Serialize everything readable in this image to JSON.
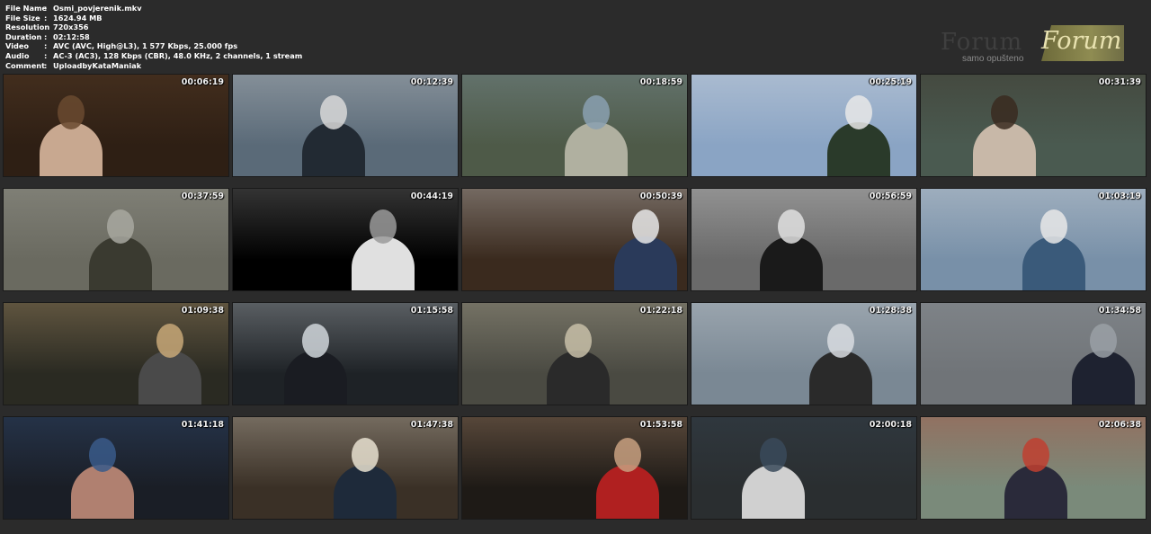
{
  "info": [
    {
      "key": "File Name",
      "value": "Osmi_povjerenik.mkv"
    },
    {
      "key": "File Size",
      "value": "1624.94 MB"
    },
    {
      "key": "Resolution",
      "value": "720x356"
    },
    {
      "key": "Duration",
      "value": "02:12:58"
    },
    {
      "key": "Video",
      "value": "AVC (AVC, High@L3), 1 577 Kbps, 25.000 fps"
    },
    {
      "key": "Audio",
      "value": "AC-3 (AC3), 128 Kbps (CBR), 48.0 KHz, 2 channels, 1 stream"
    },
    {
      "key": "Comment",
      "value": "UploadbyKataManiak"
    }
  ],
  "logo": {
    "text": "Forum",
    "sub": "samo opušteno"
  },
  "thumbs": [
    {
      "ts": "00:06:19",
      "bg": "#2e1f14",
      "c1": "#6a4a30",
      "c2": "#c8a890"
    },
    {
      "ts": "00:12:39",
      "bg": "#5a6a78",
      "c1": "#d8d8d8",
      "c2": "#222a33"
    },
    {
      "ts": "00:18:59",
      "bg": "#4e5a48",
      "c1": "#8aa0b0",
      "c2": "#b0b0a0"
    },
    {
      "ts": "00:25:19",
      "bg": "#8aa4c4",
      "c1": "#e8e8e8",
      "c2": "#2a3a2a"
    },
    {
      "ts": "00:31:39",
      "bg": "#4a5a50",
      "c1": "#3a2a20",
      "c2": "#c8b8a8"
    },
    {
      "ts": "00:37:59",
      "bg": "#6a6a60",
      "c1": "#a8a8a0",
      "c2": "#3a3a30"
    },
    {
      "ts": "00:44:19",
      "bg": "#000000",
      "c1": "#9a9a9a",
      "c2": "#e0e0e0"
    },
    {
      "ts": "00:50:39",
      "bg": "#3a2a1e",
      "c1": "#e8e8e8",
      "c2": "#2a3a5a"
    },
    {
      "ts": "00:56:59",
      "bg": "#6a6a6a",
      "c1": "#e0e0e0",
      "c2": "#1a1a1a"
    },
    {
      "ts": "01:03:19",
      "bg": "#7890a8",
      "c1": "#e8e8e8",
      "c2": "#3a5a7a"
    },
    {
      "ts": "01:09:38",
      "bg": "#2a2a22",
      "c1": "#c8a878",
      "c2": "#4a4a4a"
    },
    {
      "ts": "01:15:58",
      "bg": "#1e2226",
      "c1": "#d0d6da",
      "c2": "#1a1c22"
    },
    {
      "ts": "01:22:18",
      "bg": "#4a4a42",
      "c1": "#c8c0a8",
      "c2": "#2a2a2a"
    },
    {
      "ts": "01:28:38",
      "bg": "#7a8894",
      "c1": "#d8dce0",
      "c2": "#2a2a2a"
    },
    {
      "ts": "01:34:58",
      "bg": "#707478",
      "c1": "#9aa0a6",
      "c2": "#1e2230"
    },
    {
      "ts": "01:41:18",
      "bg": "#1a1e26",
      "c1": "#3a5a8a",
      "c2": "#b08070"
    },
    {
      "ts": "01:47:38",
      "bg": "#3a3026",
      "c1": "#e8e0d0",
      "c2": "#1e2a3a"
    },
    {
      "ts": "01:53:58",
      "bg": "#1e1a16",
      "c1": "#c8a080",
      "c2": "#b02020"
    },
    {
      "ts": "02:00:18",
      "bg": "#2a2e30",
      "c1": "#3a4a5a",
      "c2": "#d0d0d0"
    },
    {
      "ts": "02:06:38",
      "bg": "#7a8a7a",
      "c1": "#c04030",
      "c2": "#2a2a3a"
    }
  ]
}
